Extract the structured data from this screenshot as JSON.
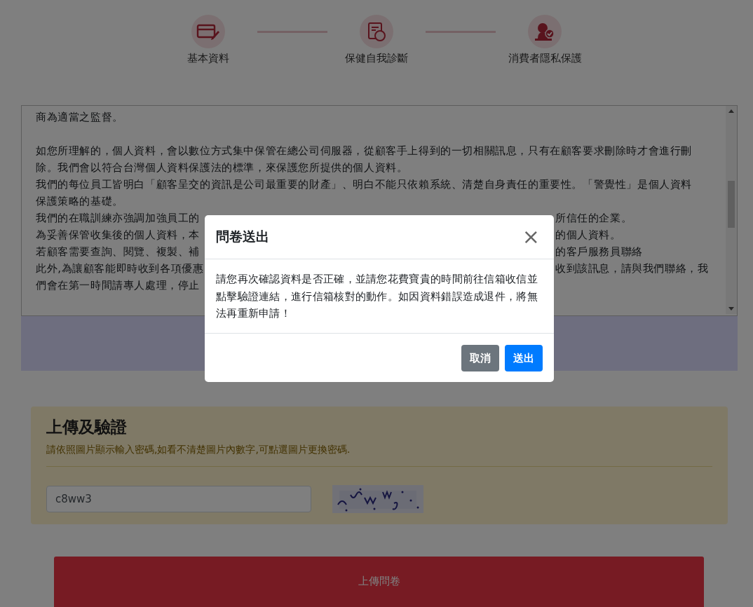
{
  "steps": [
    {
      "label": "基本資料"
    },
    {
      "label": "保健自我診斷"
    },
    {
      "label": "消費者隱私保護"
    }
  ],
  "terms": {
    "lines": [
      {
        "kind": "text",
        "left": "商為適當之監督。"
      },
      {
        "kind": "blank"
      },
      {
        "kind": "text",
        "left": "如您所理解的，個人資料，會以數位方式集中保管在總公司伺服器，從顧客手上得到的一切相關訊息，只有在顧客要求刪除時才會進行刪"
      },
      {
        "kind": "text",
        "left": "除。我們會以符合台灣個人資料保護法的標準，來保護您所提供的個人資料。"
      },
      {
        "kind": "text",
        "left": "我們的每位員工皆明白「顧客呈交的資訊是公司最重要的財產」、明白不能只依賴系統、清楚自身責任的重要性。「警覺性」是個人資料"
      },
      {
        "kind": "text",
        "left": "保護策略的基礎。"
      },
      {
        "kind": "split",
        "left": "我們的在職訓練亦強調加強員工的",
        "right": "所信任的企業。"
      },
      {
        "kind": "split",
        "left": "為妥善保管收集後的個人資料，本",
        "right": "的個人資料。"
      },
      {
        "kind": "split",
        "left": "若顧客需要查詢、閱覽、複製、補",
        "right": "的客戶服務員聯絡"
      },
      {
        "kind": "split",
        "left": "此外,為讓顧客能即時收到各項優惠",
        "right": "收到該訊息，請與我們聯絡，我"
      },
      {
        "kind": "split",
        "left": "們會在第一時間請專人處理，停止"
      }
    ]
  },
  "upload": {
    "title": "上傳及驗證",
    "hint": "請依照圖片顯示輸入密碼,如看不清楚圖片內數字,可點選圖片更換密碼.",
    "captcha_input": {
      "value": "c8ww3"
    }
  },
  "submit_button": "上傳問卷",
  "modal": {
    "title": "問卷送出",
    "close": "×",
    "body": "請您再次確認資料是否正確，並請您花費寶貴的時間前往信箱收信並點擊驗證連結，進行信箱核對的動作。如因資料錯誤造成退件，將無法再重新申請！",
    "buttons": [
      {
        "label": "取消",
        "kind": "secondary"
      },
      {
        "label": "送出",
        "kind": "primary"
      }
    ]
  }
}
